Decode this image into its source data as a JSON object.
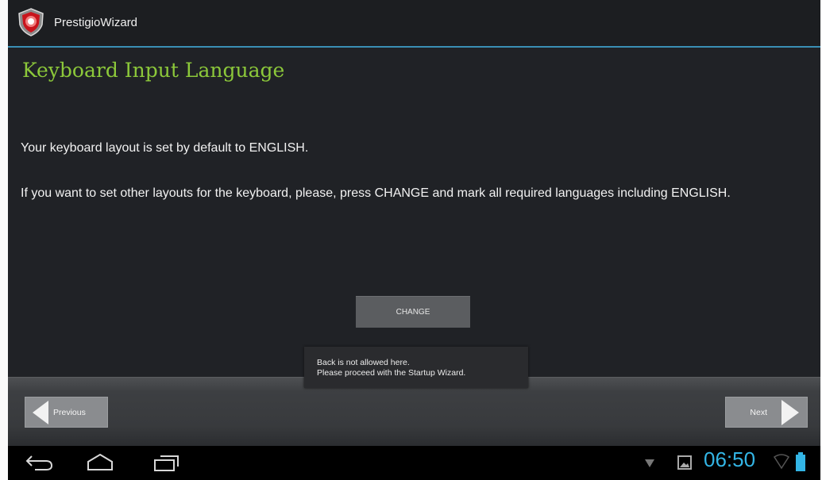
{
  "app": {
    "title": "PrestigioWizard",
    "icon": "prestigio-logo-icon"
  },
  "page": {
    "heading": "Keyboard Input Language",
    "paragraph1": "Your keyboard layout is set by default to ENGLISH.",
    "paragraph2": "If you want to set other layouts for the keyboard, please, press CHANGE and mark all required languages including ENGLISH.",
    "change_label": "CHANGE"
  },
  "toast": {
    "line1": "Back is not allowed here.",
    "line2": "Please proceed with the Startup Wizard."
  },
  "navigation": {
    "previous_label": "Previous",
    "next_label": "Next"
  },
  "system_bar": {
    "clock": "06:50",
    "icons": [
      "back-icon",
      "home-icon",
      "recent-apps-icon",
      "notification-icon",
      "gallery-icon",
      "wifi-icon",
      "battery-icon"
    ]
  },
  "colors": {
    "accent_blue": "#33b5e5",
    "heading_green": "#8cc83a",
    "background": "#202226"
  }
}
